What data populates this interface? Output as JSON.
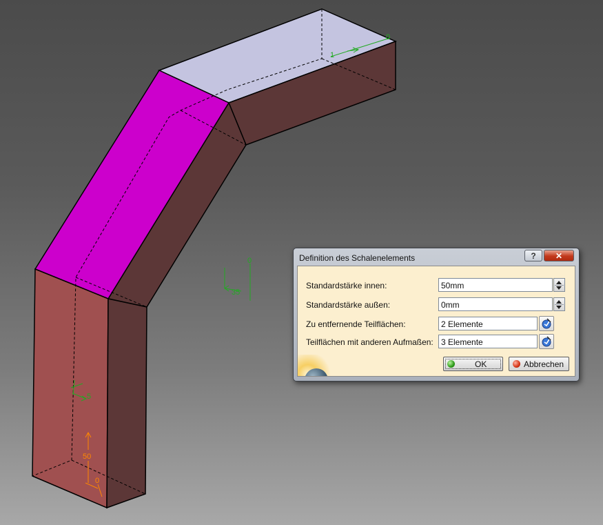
{
  "viewport": {
    "annotations": {
      "top_marker_zero": "0",
      "top_marker_one": "1",
      "right_marker_zero": "0",
      "right_marker_35": "35",
      "left_marker_5": "5",
      "bottom_marker_50": "50",
      "bottom_marker_zero": "0"
    },
    "colors": {
      "background_top": "#4b4b4b",
      "background_bottom": "#a8a8a8",
      "selected_face": "#cc00cc",
      "top_face": "#c4c4e0",
      "side_face_dark": "#5c3737",
      "front_face": "#a05050",
      "annotation_green": "#22aa22",
      "annotation_orange": "#ff8800"
    }
  },
  "dialog": {
    "title": "Definition des Schalenelements",
    "help_label": "?",
    "close_label": "✕",
    "rows": [
      {
        "label": "Standardstärke innen:",
        "value": "50mm",
        "kind": "spinner"
      },
      {
        "label": "Standardstärke außen:",
        "value": "0mm",
        "kind": "spinner"
      },
      {
        "label": "Zu entfernende Teilflächen:",
        "value": "2 Elemente",
        "kind": "selector"
      },
      {
        "label": "Teilflächen mit anderen Aufmaßen:",
        "value": "3 Elemente",
        "kind": "selector"
      }
    ],
    "ok_label": "OK",
    "cancel_label": "Abbrechen"
  }
}
